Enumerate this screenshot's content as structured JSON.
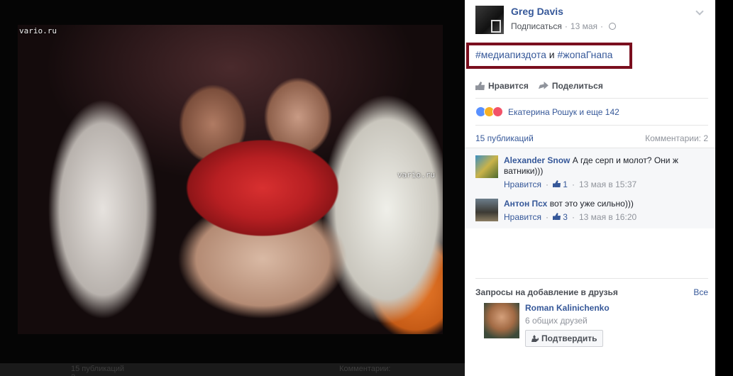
{
  "photo": {
    "watermark_top": "vario.ru",
    "watermark_mid": "vario.ru"
  },
  "bottom_strip": {
    "left_text": "15 публикаций",
    "right_text": "Комментарии: 2"
  },
  "post": {
    "author": "Greg Davis",
    "follow_label": "Подписаться",
    "date": "13 мая",
    "tag1": "#медиапиздота",
    "conjunction": " и ",
    "tag2": "#жопаГнапа"
  },
  "actions": {
    "like": "Нравится",
    "share": "Поделиться"
  },
  "reactions": {
    "names": "Екатерина Рошук и еще 142"
  },
  "counts": {
    "publications": "15 публикаций",
    "comments": "Комментарии: 2"
  },
  "comments": [
    {
      "author": "Alexander Snow",
      "text": "А где серп и молот? Они ж ватники)))",
      "like_label": "Нравится",
      "likes": "1",
      "time": "13 мая в 15:37"
    },
    {
      "author": "Антон Псх",
      "text": "вот это уже сильно)))",
      "like_label": "Нравится",
      "likes": "3",
      "time": "13 мая в 16:20"
    }
  ],
  "friend_requests": {
    "title": "Запросы на добавление в друзья",
    "see_all": "Все",
    "item": {
      "name": "Roman Kalinichenko",
      "mutual": "6 общих друзей",
      "confirm": "Подтвердить"
    }
  },
  "colors": {
    "link": "#365899",
    "highlight_border": "#7a0e1e"
  }
}
